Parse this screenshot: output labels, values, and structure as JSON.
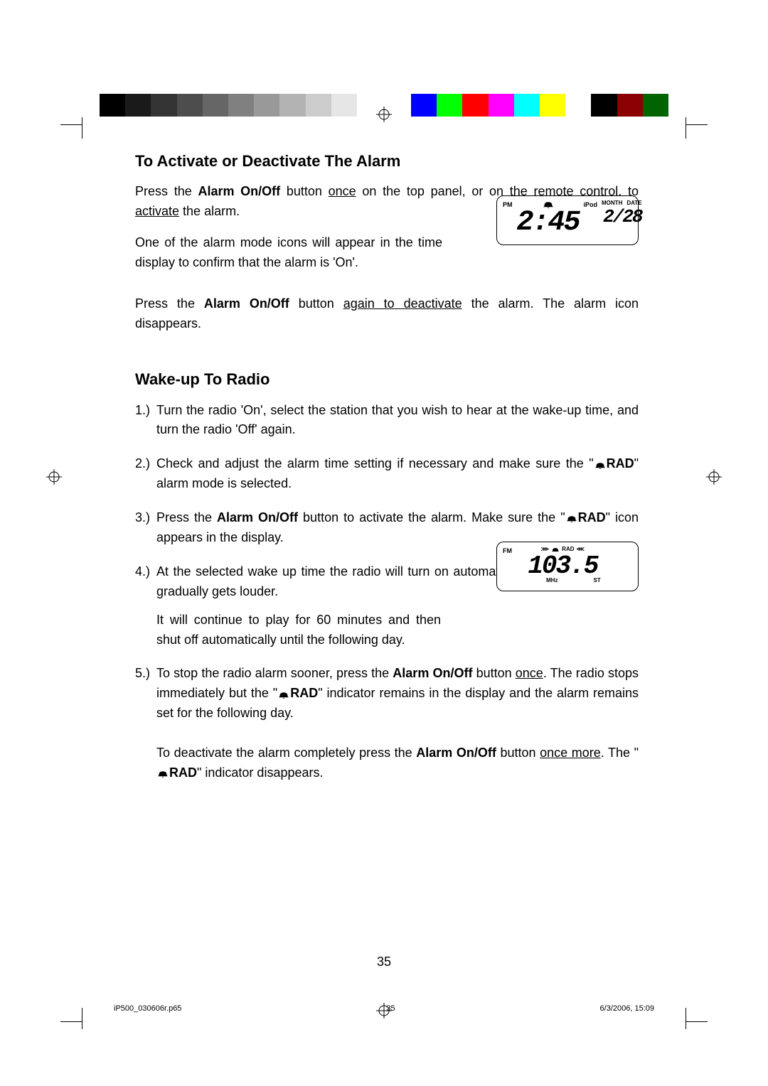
{
  "colorbar": {
    "grays": [
      "#000000",
      "#1a1a1a",
      "#333333",
      "#4d4d4d",
      "#666666",
      "#808080",
      "#999999",
      "#b3b3b3",
      "#cccccc",
      "#e6e6e6",
      "#ffffff"
    ],
    "colors": [
      "#0000ff",
      "#00ff00",
      "#ff0000",
      "#ff00ff",
      "#00ffff",
      "#ffff00",
      "#ffffff",
      "#000000",
      "#8b0000",
      "#006400"
    ]
  },
  "h1": "To Activate or Deactivate The Alarm",
  "p1a": "Press the ",
  "p1b": "Alarm On/Off",
  "p1c": " button ",
  "p1d": "once",
  "p1e": " on the top panel, or on the remote control, to ",
  "p1f": "activate",
  "p1g": " the alarm.",
  "p2": "One of the alarm mode icons will appear in the time display to confirm that the alarm is 'On'.",
  "p3a": "Press the ",
  "p3b": "Alarm On/Off",
  "p3c": " button ",
  "p3d": "again to deactivate",
  "p3e": " the alarm. The alarm icon disappears.",
  "h2": "Wake-up To Radio",
  "li1": "Turn the radio 'On', select the station that you wish to hear at the wake-up time, and turn the radio 'Off' again.",
  "li2a": "Check and adjust the alarm time setting if necessary and make sure the \"",
  "li2b": "RAD",
  "li2c": "\" alarm mode is selected.",
  "li3a": "Press the ",
  "li3b": "Alarm On/Off",
  "li3c": " button to activate the alarm. Make sure the \"",
  "li3d": "RAD",
  "li3e": "\" icon appears in the display.",
  "li4a": "At the selected wake up time the radio will turn on automatically. It starts softly and gradually gets louder.",
  "li4b": "It will continue to play for 60 minutes and then shut off automatically until the following day.",
  "li5a": "To stop the radio alarm sooner, press the ",
  "li5b": "Alarm On/Off",
  "li5c": " button ",
  "li5d": "once",
  "li5e": ". The radio stops immediately but the \"",
  "li5f": "RAD",
  "li5g": "\" indicator remains in the display and the alarm remains set for the following day.",
  "li5h": "To deactivate the alarm completely press the ",
  "li5i": "Alarm On/Off",
  "li5j": " button ",
  "li5k": "once more",
  "li5l": ". The \"",
  "li5m": "RAD",
  "li5n": "\" indicator disappears.",
  "nums": {
    "1": "1.)",
    "2": "2.)",
    "3": "3.)",
    "4": "4.)",
    "5": "5.)"
  },
  "lcd1": {
    "pm": "PM",
    "ipod": "iPod",
    "month": "MONTH",
    "date": "DATE",
    "time": "2:45",
    "mmdd": "2/28"
  },
  "lcd2": {
    "fm": "FM",
    "rad": "RAD",
    "freq": "103.5",
    "mhz": "MHz",
    "st": "ST"
  },
  "page": "35",
  "footer": {
    "file": "iP500_030606r.p65",
    "pg": "35",
    "timestamp": "6/3/2006, 15:09"
  }
}
